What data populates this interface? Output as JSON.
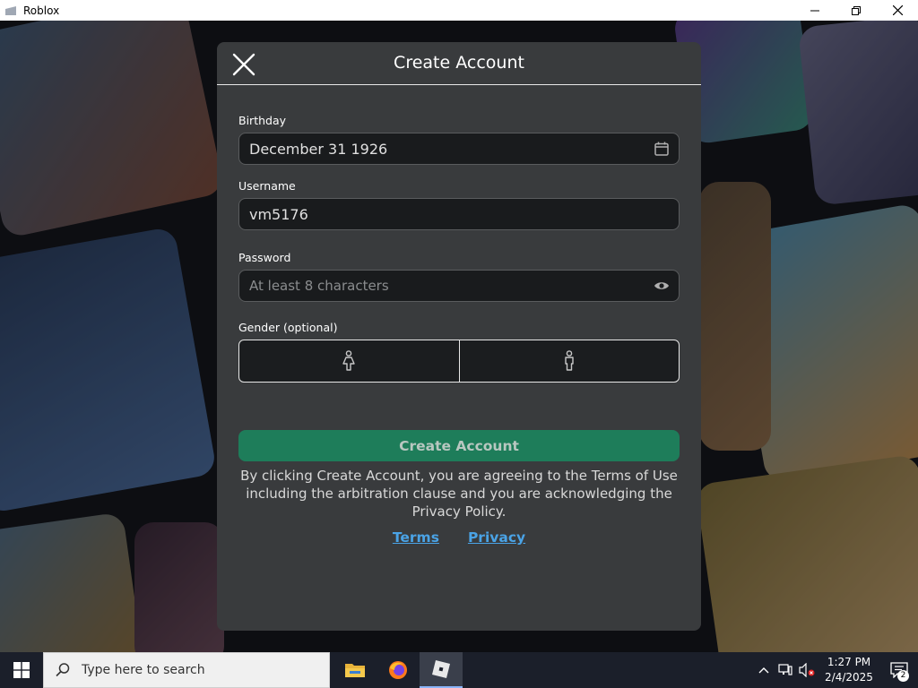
{
  "window": {
    "title": "Roblox"
  },
  "modal": {
    "title": "Create Account",
    "birthday": {
      "label": "Birthday",
      "value": "December 31 1926"
    },
    "username": {
      "label": "Username",
      "value": "vm5176"
    },
    "password": {
      "label": "Password",
      "placeholder": "At least 8 characters"
    },
    "gender": {
      "label": "Gender (optional)"
    },
    "create_button": "Create Account",
    "legal_text": "By clicking Create Account, you are agreeing to the Terms of Use including the arbitration clause and you are acknowledging the Privacy Policy.",
    "links": {
      "terms": "Terms",
      "privacy": "Privacy"
    }
  },
  "taskbar": {
    "search_placeholder": "Type here to search",
    "time": "1:27 PM",
    "date": "2/4/2025",
    "notification_count": "2"
  },
  "colors": {
    "modal_bg": "#393b3d",
    "button_green": "#1e7d5a",
    "link_blue": "#4aa3e6"
  }
}
